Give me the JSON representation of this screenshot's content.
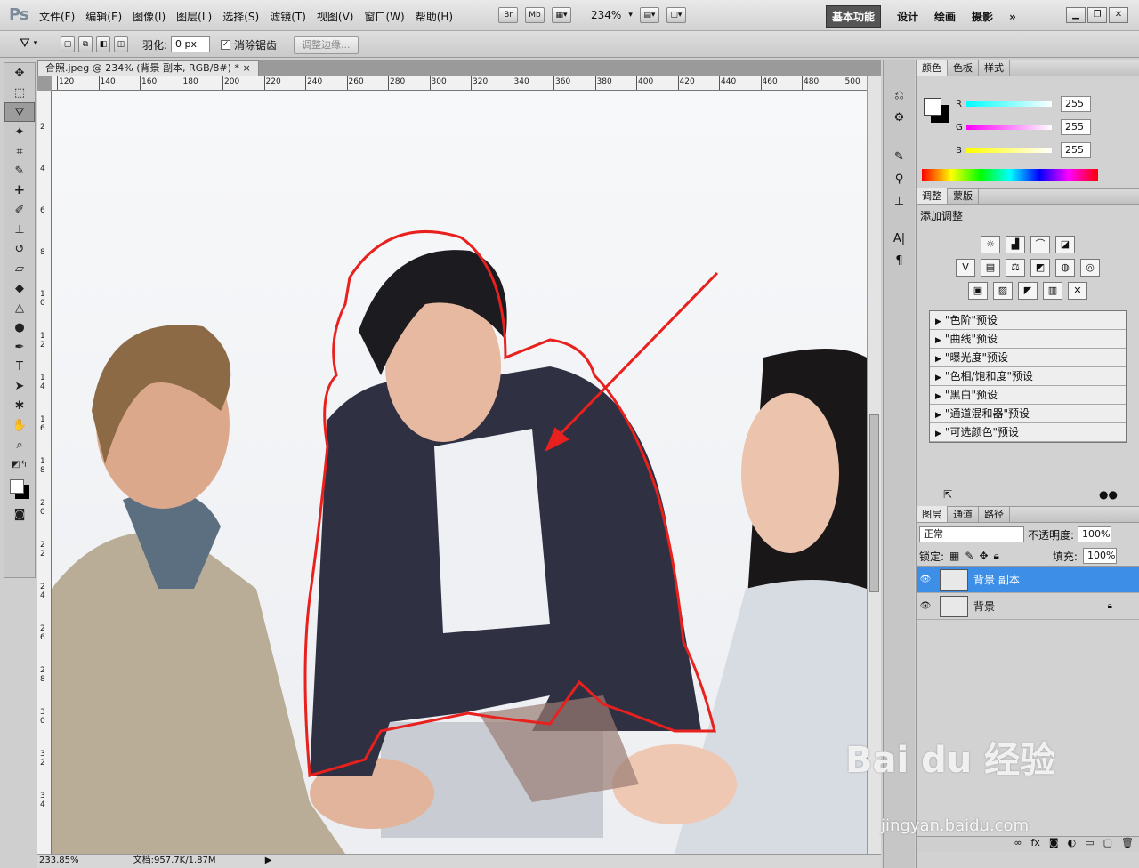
{
  "app": {
    "logo": "Ps",
    "menus": [
      "文件(F)",
      "编辑(E)",
      "图像(I)",
      "图层(L)",
      "选择(S)",
      "滤镜(T)",
      "视图(V)",
      "窗口(W)",
      "帮助(H)"
    ],
    "tool_badges": [
      "Br",
      "Mb"
    ],
    "zoom": "234%"
  },
  "workspaces": {
    "active": "基本功能",
    "others": [
      "设计",
      "绘画",
      "摄影"
    ],
    "more": "»"
  },
  "options": {
    "feather_label": "羽化:",
    "feather_value": "0 px",
    "antialias_label": "消除锯齿",
    "refine_edge": "调整边缘..."
  },
  "document": {
    "tab": "合照.jpeg @ 234% (背景 副本, RGB/8#) *",
    "close": "×",
    "ruler_h": [
      "120",
      "140",
      "160",
      "180",
      "200",
      "220",
      "240",
      "260",
      "280",
      "300",
      "320",
      "340",
      "360",
      "380",
      "400",
      "420",
      "440",
      "460",
      "480",
      "500"
    ],
    "ruler_v": [
      "2",
      "4",
      "6",
      "8",
      "1\n0",
      "1\n2",
      "1\n4",
      "1\n6",
      "1\n8",
      "2\n0",
      "2\n2",
      "2\n4",
      "2\n6",
      "2\n8",
      "3\n0",
      "3\n2",
      "3\n4"
    ],
    "status_zoom": "233.85%",
    "status_doc": "文档:957.7K/1.87M"
  },
  "color_panel": {
    "tabs": [
      "颜色",
      "色板",
      "样式"
    ],
    "channels": [
      {
        "label": "R",
        "value": "255",
        "color": "#00e5ff"
      },
      {
        "label": "G",
        "value": "255",
        "color": "#ff20ff"
      },
      {
        "label": "B",
        "value": "255",
        "color": "#f0f000"
      }
    ]
  },
  "adjust_panel": {
    "tabs": [
      "调整",
      "蒙版"
    ],
    "title": "添加调整",
    "presets": [
      "\"色阶\"预设",
      "\"曲线\"预设",
      "\"曝光度\"预设",
      "\"色相/饱和度\"预设",
      "\"黑白\"预设",
      "\"通道混和器\"预设",
      "\"可选颜色\"预设"
    ]
  },
  "layers_panel": {
    "tabs": [
      "图层",
      "通道",
      "路径"
    ],
    "blend_mode": "正常",
    "opacity_label": "不透明度:",
    "opacity": "100%",
    "lock_label": "锁定:",
    "fill_label": "填充:",
    "fill": "100%",
    "layers": [
      {
        "name": "背景 副本",
        "selected": true
      },
      {
        "name": "背景",
        "selected": false
      }
    ]
  },
  "watermark": {
    "brand": "Bai du 经验",
    "url": "jingyan.baidu.com"
  },
  "colors": {
    "selection": "#e8201e",
    "accent": "#3d8ee6"
  }
}
